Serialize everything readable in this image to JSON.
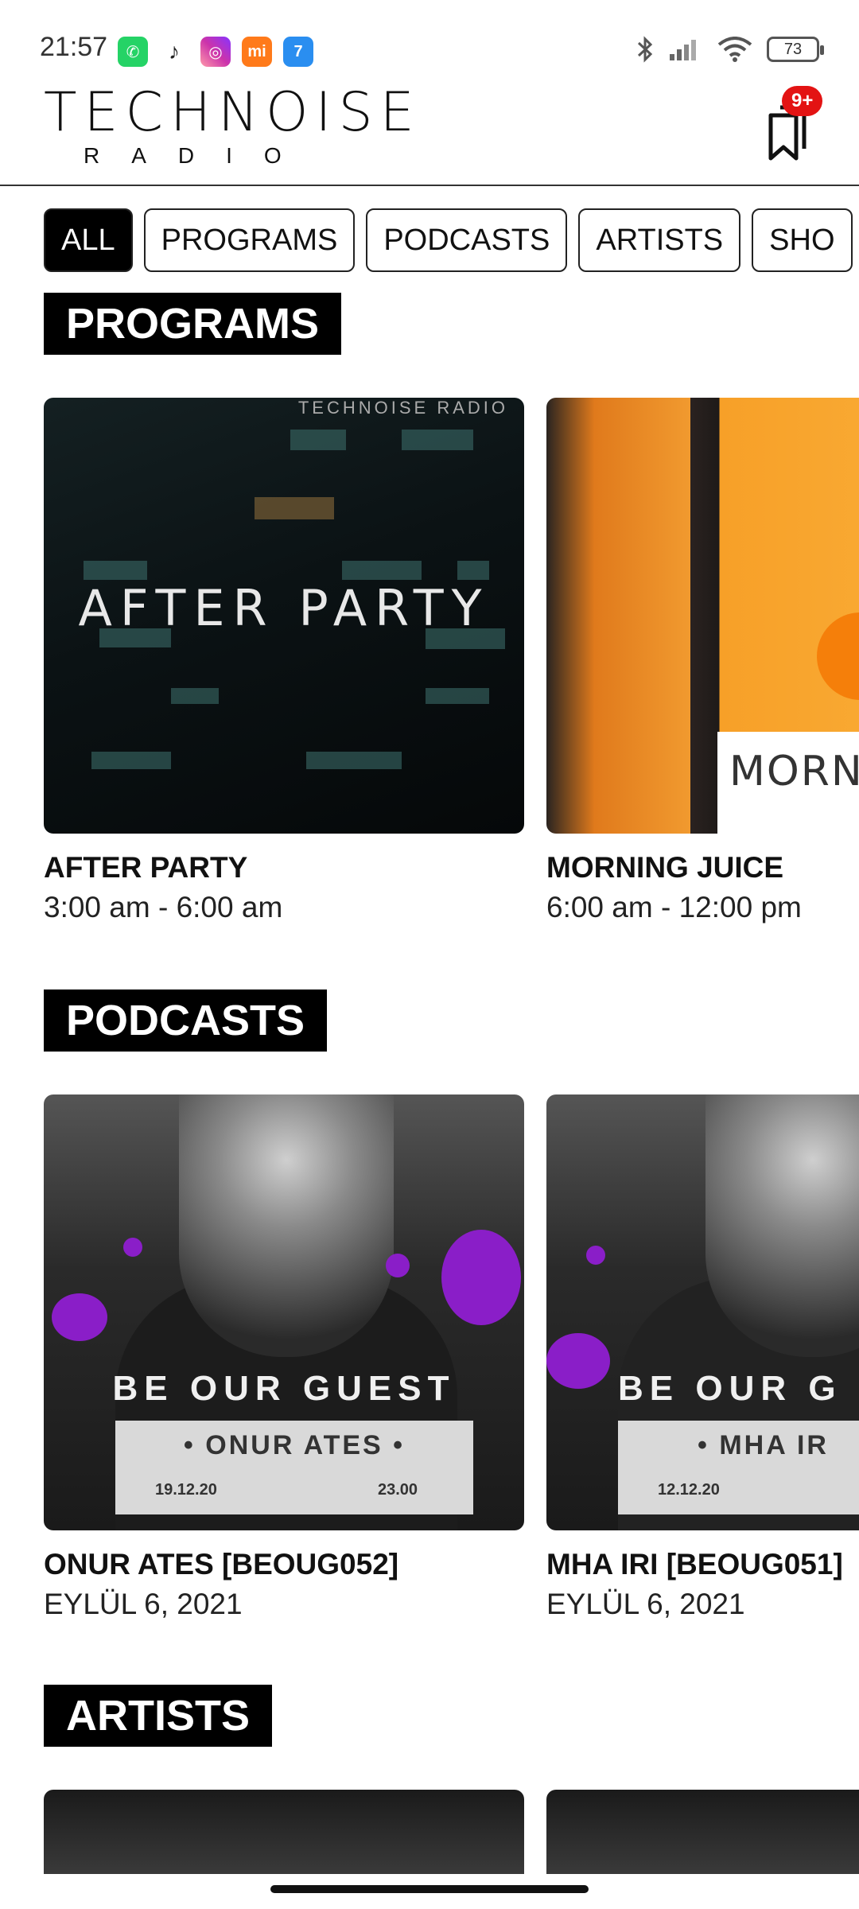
{
  "status_bar": {
    "time": "21:57",
    "battery": "73",
    "app_icons": [
      "whatsapp-icon",
      "tiktok-icon",
      "instagram-icon",
      "mi-icon",
      "seven-icon"
    ]
  },
  "header": {
    "logo_main": "TECHNOISE",
    "logo_sub": "RADIO",
    "notification_badge": "9+"
  },
  "filters": {
    "tabs": [
      {
        "label": "ALL",
        "active": true
      },
      {
        "label": "PROGRAMS",
        "active": false
      },
      {
        "label": "PODCASTS",
        "active": false
      },
      {
        "label": "ARTISTS",
        "active": false
      },
      {
        "label": "SHO",
        "active": false
      }
    ]
  },
  "sections": {
    "programs": {
      "title": "PROGRAMS",
      "items": [
        {
          "title": "AFTER PARTY",
          "subtitle": "3:00 am - 6:00 am",
          "art_text": "AFTER PARTY",
          "art_logo": "TECHNOISE RADIO"
        },
        {
          "title": "MORNING JUICE",
          "subtitle": "6:00 am - 12:00 pm",
          "art_text": "MORNIN"
        }
      ]
    },
    "podcasts": {
      "title": "PODCASTS",
      "items": [
        {
          "title": "ONUR ATES [BEOUG052]",
          "subtitle": "EYLÜL 6, 2021",
          "art_headline": "BE OUR GUEST",
          "art_name": "• ONUR ATES •",
          "art_date": "19.12.20",
          "art_hour": "23.00"
        },
        {
          "title": "MHA IRI [BEOUG051]",
          "subtitle": "EYLÜL 6, 2021",
          "art_headline": "BE OUR G",
          "art_name": "• MHA IR",
          "art_date": "12.12.20"
        }
      ]
    },
    "artists": {
      "title": "ARTISTS"
    }
  },
  "colors": {
    "accent": "#000000",
    "badge": "#e31313",
    "background": "#ffffff"
  }
}
